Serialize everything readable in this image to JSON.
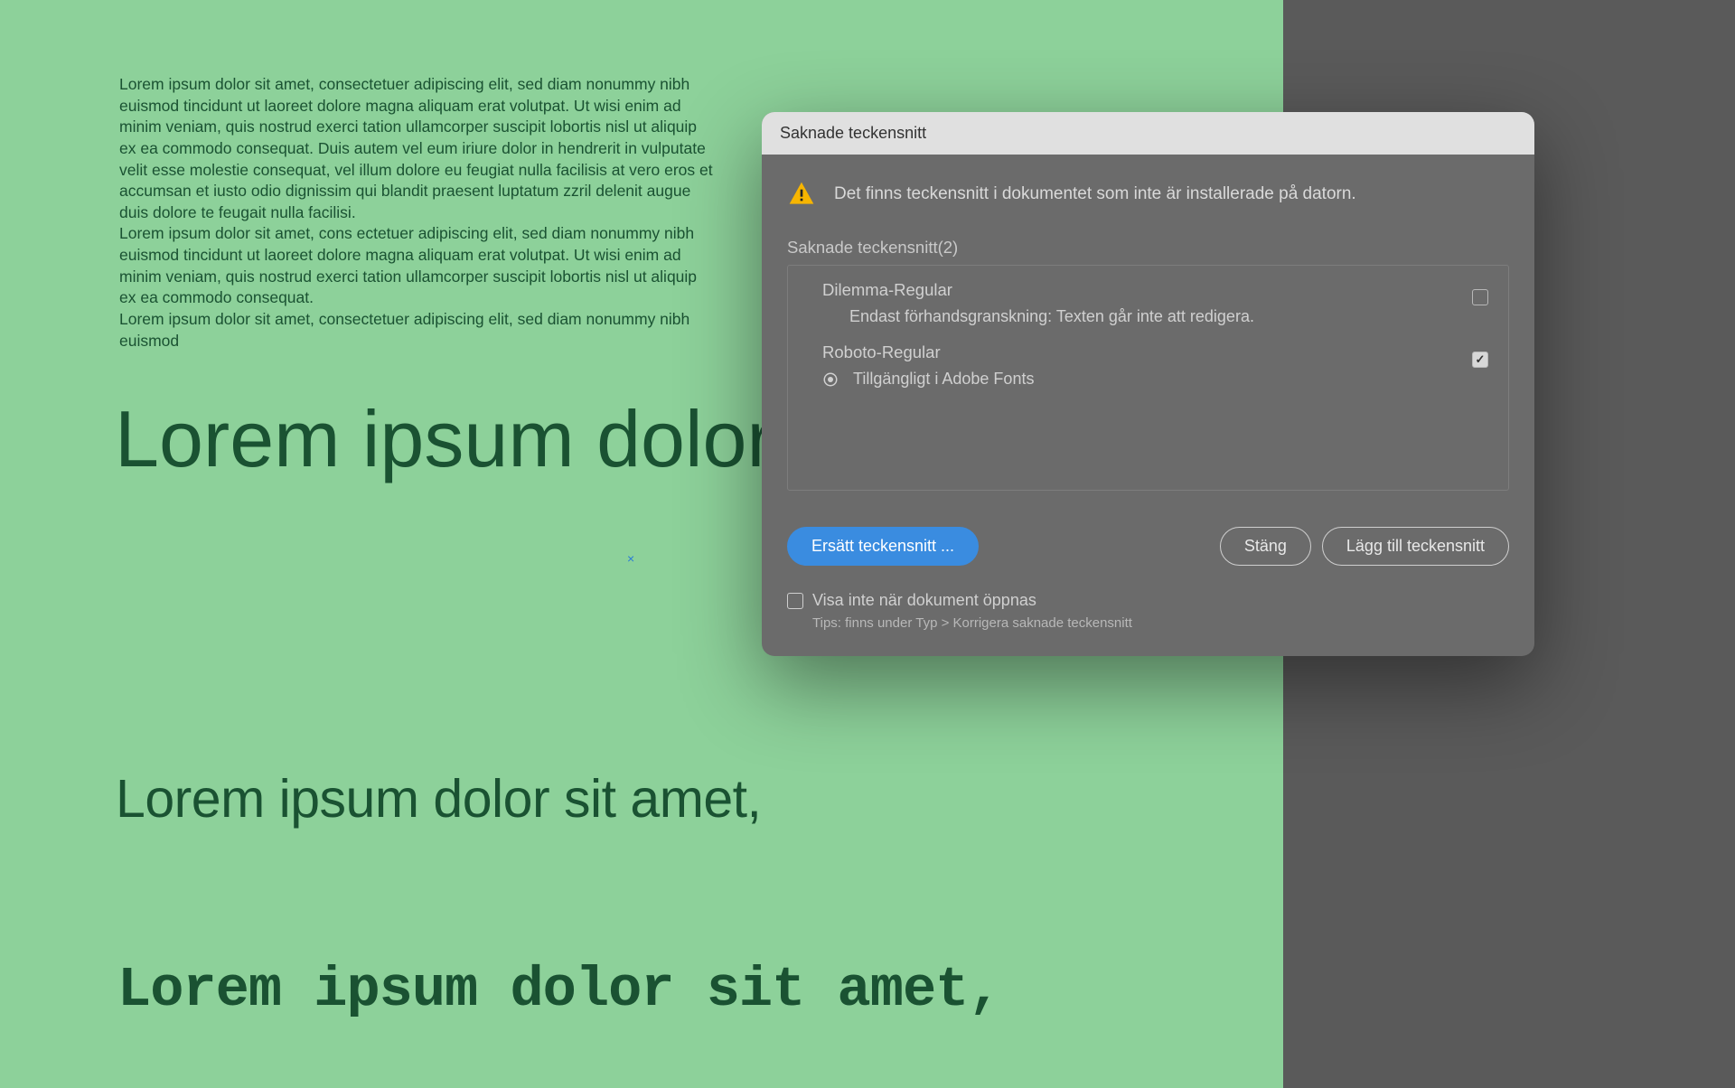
{
  "canvas": {
    "body_text": "Lorem ipsum dolor sit amet, consectetuer adipiscing elit, sed diam nonummy nibh euismod tincidunt ut laoreet dolore magna aliquam erat volutpat. Ut wisi enim ad minim veniam, quis nostrud exerci tation ullamcorper suscipit lobortis nisl ut aliquip ex ea commodo consequat. Duis autem vel eum iriure dolor in hendrerit in vulputate velit esse molestie consequat, vel illum dolore eu feugiat nulla facilisis at vero eros et accumsan et iusto odio dignissim qui blandit praesent luptatum zzril delenit augue duis dolore te feugait nulla facilisi.\nLorem ipsum dolor sit amet, cons ectetuer adipiscing elit, sed diam nonummy nibh euismod tincidunt ut laoreet dolore magna aliquam erat volutpat. Ut wisi enim ad minim veniam, quis nostrud exerci tation ullamcorper suscipit lobortis nisl ut aliquip ex ea commodo consequat.\nLorem ipsum dolor sit amet, consectetuer adipiscing elit, sed diam nonummy nibh euismod",
    "heading1": "Lorem ipsum dolor sit amet,",
    "heading2": "Lorem ipsum dolor sit amet,",
    "heading3": "Lorem ipsum dolor sit amet,",
    "anchor_mark": "×"
  },
  "dialog": {
    "title": "Saknade teckensnitt",
    "warning": "Det finns teckensnitt i dokumentet som inte är installerade på datorn.",
    "list_label": "Saknade teckensnitt(2)",
    "fonts": [
      {
        "name": "Dilemma-Regular",
        "sub": "Endast förhandsgranskning: Texten går inte att redigera.",
        "checked": false,
        "adobe": false
      },
      {
        "name": "Roboto-Regular",
        "sub": "Tillgängligt i Adobe Fonts",
        "checked": true,
        "adobe": true
      }
    ],
    "buttons": {
      "replace": "Ersätt teckensnitt ...",
      "close": "Stäng",
      "add": "Lägg till teckensnitt"
    },
    "dont_show": "Visa inte när dokument öppnas",
    "tip": "Tips: finns under Typ > Korrigera saknade teckensnitt"
  }
}
